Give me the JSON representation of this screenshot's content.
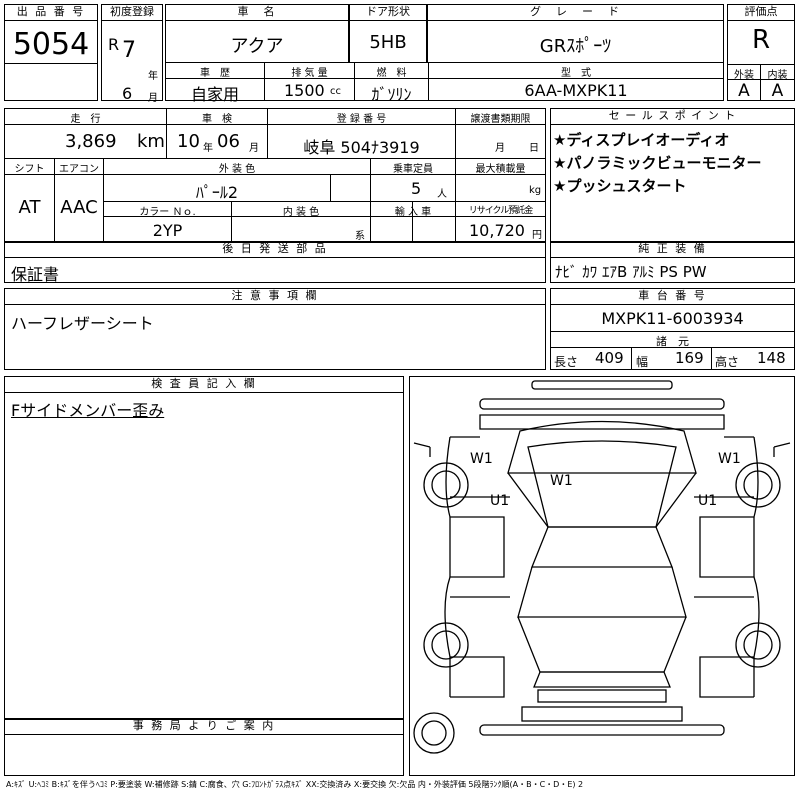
{
  "lot": {
    "label": "出 品 番 号",
    "value": "5054"
  },
  "first_reg": {
    "label": "初度登録",
    "era": "R",
    "year": "7",
    "year_unit": "年",
    "month": "6",
    "month_unit": "月"
  },
  "car_name": {
    "label": "車　名",
    "value": "アクア"
  },
  "door": {
    "label": "ドア形状",
    "value": "5HB"
  },
  "grade": {
    "label": "グ　レ　ー　ド",
    "value": "GRｽﾎﾟｰﾂ"
  },
  "rating": {
    "label": "評価点",
    "value": "R",
    "ext_label": "外装",
    "int_label": "内装",
    "ext": "A",
    "int": "A"
  },
  "history": {
    "label": "車　歴",
    "value": "自家用"
  },
  "displacement": {
    "label": "排 気 量",
    "value": "1500",
    "unit": "cc"
  },
  "fuel": {
    "label": "燃　料",
    "value": "ｶﾞｿﾘﾝ"
  },
  "model": {
    "label": "型　式",
    "value": "6AA-MXPK11"
  },
  "mileage": {
    "label": "走　行",
    "value": "3,869",
    "unit": "km"
  },
  "inspection": {
    "label": "車　検",
    "year": "10",
    "year_unit": "年",
    "month": "06",
    "month_unit": "月"
  },
  "plate": {
    "label": "登 録 番 号",
    "value": "岐阜 504ﾅ3919"
  },
  "transfer": {
    "label": "譲渡書類期限",
    "month_unit": "月",
    "day_unit": "日"
  },
  "shift": {
    "label": "シフト",
    "value": "AT"
  },
  "aircon": {
    "label": "エアコン",
    "value": "AAC"
  },
  "ext_color": {
    "label": "外 装 色",
    "value": "ﾊﾟｰﾙ2"
  },
  "capacity": {
    "label": "乗車定員",
    "value": "5",
    "unit": "人"
  },
  "load": {
    "label": "最大積載量",
    "unit": "kg"
  },
  "color_no": {
    "label": "カラー Ｎｏ.",
    "value": "2YP"
  },
  "int_color": {
    "label": "内 装 色",
    "unit": "系"
  },
  "import": {
    "label": "輸 入 車"
  },
  "recycle": {
    "label": "リサイクル預託金",
    "value": "10,720",
    "unit": "円"
  },
  "later_parts": {
    "label": "後 日 発 送 部 品",
    "value": "保証書"
  },
  "sales_points": {
    "label": "セ ー ル ス ポ イ ン ト",
    "items": [
      "★ディスプレイオーディオ",
      "★パノラミックビューモニター",
      "★プッシュスタート"
    ]
  },
  "genuine": {
    "label": "純 正 装 備",
    "value": "ﾅﾋﾞ ｶﾜ ｴｱB ｱﾙﾐ PS PW"
  },
  "notes": {
    "label": "注 意 事 項 欄",
    "value": "ハーフレザーシート"
  },
  "chassis": {
    "label": "車 台 番 号",
    "value": "MXPK11-6003934"
  },
  "dims": {
    "label": "諸　元",
    "len_label": "長さ",
    "len": "409",
    "wid_label": "幅",
    "wid": "169",
    "hgt_label": "高さ",
    "hgt": "148"
  },
  "inspector": {
    "label": "検 査 員 記 入 欄",
    "value": "Fサイドメンバー歪み"
  },
  "office": {
    "label": "事 務 局 よ り ご 案 内"
  },
  "diagram": {
    "marks": [
      "W1",
      "W1",
      "W1",
      "U1",
      "U1"
    ]
  },
  "legend": "A:ｷｽﾞ U:ﾍｺﾐ B:ｷｽﾞを伴うﾍｺﾐ P:要塗装 W:補修跡 S:錆 C:腐食、穴 G:ﾌﾛﾝﾄｶﾞﾗｽ点ｷｽﾞ XX:交換済み X:要交換 欠:欠品 内・外装評価 5段階ﾗﾝｸ順(A・B・C・D・E) 2"
}
